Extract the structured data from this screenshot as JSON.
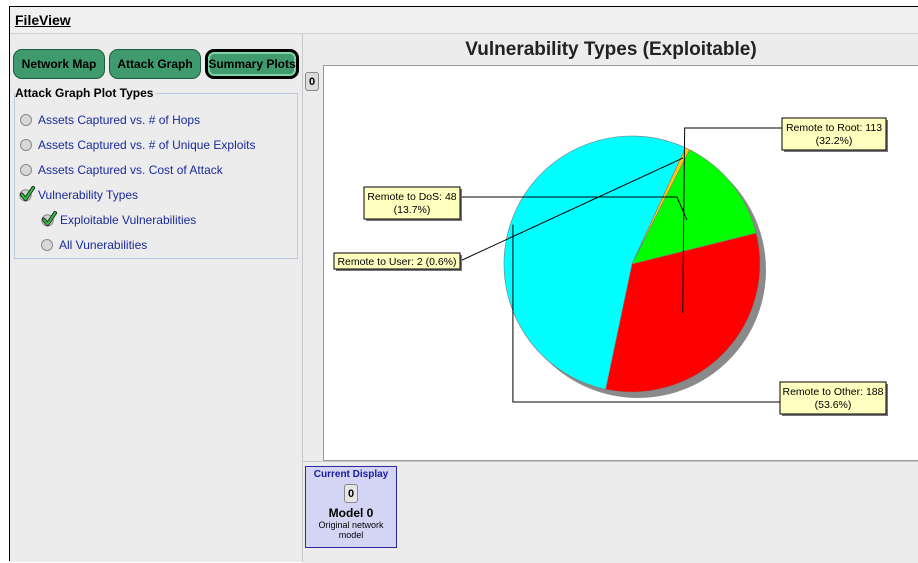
{
  "menu": {
    "file_label": "File",
    "view_label": "View"
  },
  "tabs": [
    {
      "label": "Network Map"
    },
    {
      "label": "Attack Graph"
    },
    {
      "label": "Summary Plots"
    }
  ],
  "panel": {
    "group_title": "Attack Graph Plot Types",
    "options": [
      {
        "label": "Assets Captured vs. # of Hops",
        "checked": false
      },
      {
        "label": "Assets Captured vs. # of Unique Exploits",
        "checked": false
      },
      {
        "label": "Assets Captured vs. Cost of Attack",
        "checked": false
      },
      {
        "label": "Vulnerability Types",
        "checked": true
      }
    ],
    "sub_options": [
      {
        "label": "Exploitable Vulnerabilities",
        "checked": true
      },
      {
        "label": "All Vunerabilities",
        "checked": false
      }
    ]
  },
  "chart_index": "0",
  "chart_data": {
    "type": "pie",
    "title": "Vulnerability Types (Exploitable)",
    "slices": [
      {
        "name": "Remote to Root",
        "value": 113,
        "percent": "32.2%",
        "color": "#ff0000",
        "label_line1": "Remote to Root: 113",
        "label_line2": "(32.2%)"
      },
      {
        "name": "Remote to Other",
        "value": 188,
        "percent": "53.6%",
        "color": "#00ffff",
        "label_line1": "Remote to Other: 188",
        "label_line2": "(53.6%)"
      },
      {
        "name": "Remote to User",
        "value": 2,
        "percent": "0.6%",
        "color": "#ffc800",
        "label_line1": "Remote to User: 2 (0.6%)",
        "label_line2": ""
      },
      {
        "name": "Remote to DoS",
        "value": 48,
        "percent": "13.7%",
        "color": "#00ff00",
        "label_line1": "Remote to DoS: 48",
        "label_line2": "(13.7%)"
      }
    ]
  },
  "current_display": {
    "heading": "Current Display",
    "index": "0",
    "model": "Model 0",
    "description": "Original network model"
  },
  "colors": {
    "tab_green": "#3f9a6e",
    "label_bg": "#ffffc0",
    "card_bg": "#d4d4f4"
  }
}
